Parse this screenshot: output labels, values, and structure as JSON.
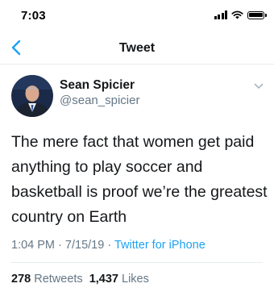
{
  "status_bar": {
    "time": "7:03"
  },
  "nav": {
    "title": "Tweet"
  },
  "tweet": {
    "author": {
      "name": "Sean Spicier",
      "handle": "@sean_spicier"
    },
    "text": "The mere fact that women get paid anything to play soccer and basketball is proof we’re the greatest country on Earth",
    "time": "1:04 PM",
    "date": "7/15/19",
    "separator": "·",
    "source": "Twitter for iPhone",
    "stats": {
      "retweets_count": "278",
      "retweets_label": "Retweets",
      "likes_count": "1,437",
      "likes_label": "Likes"
    }
  },
  "colors": {
    "accent": "#1da1f2",
    "secondary_text": "#657786",
    "divider": "#e6ecf0"
  },
  "icons": [
    "signal-icon",
    "wifi-icon",
    "battery-icon",
    "back-chevron-icon",
    "caret-down-icon"
  ]
}
